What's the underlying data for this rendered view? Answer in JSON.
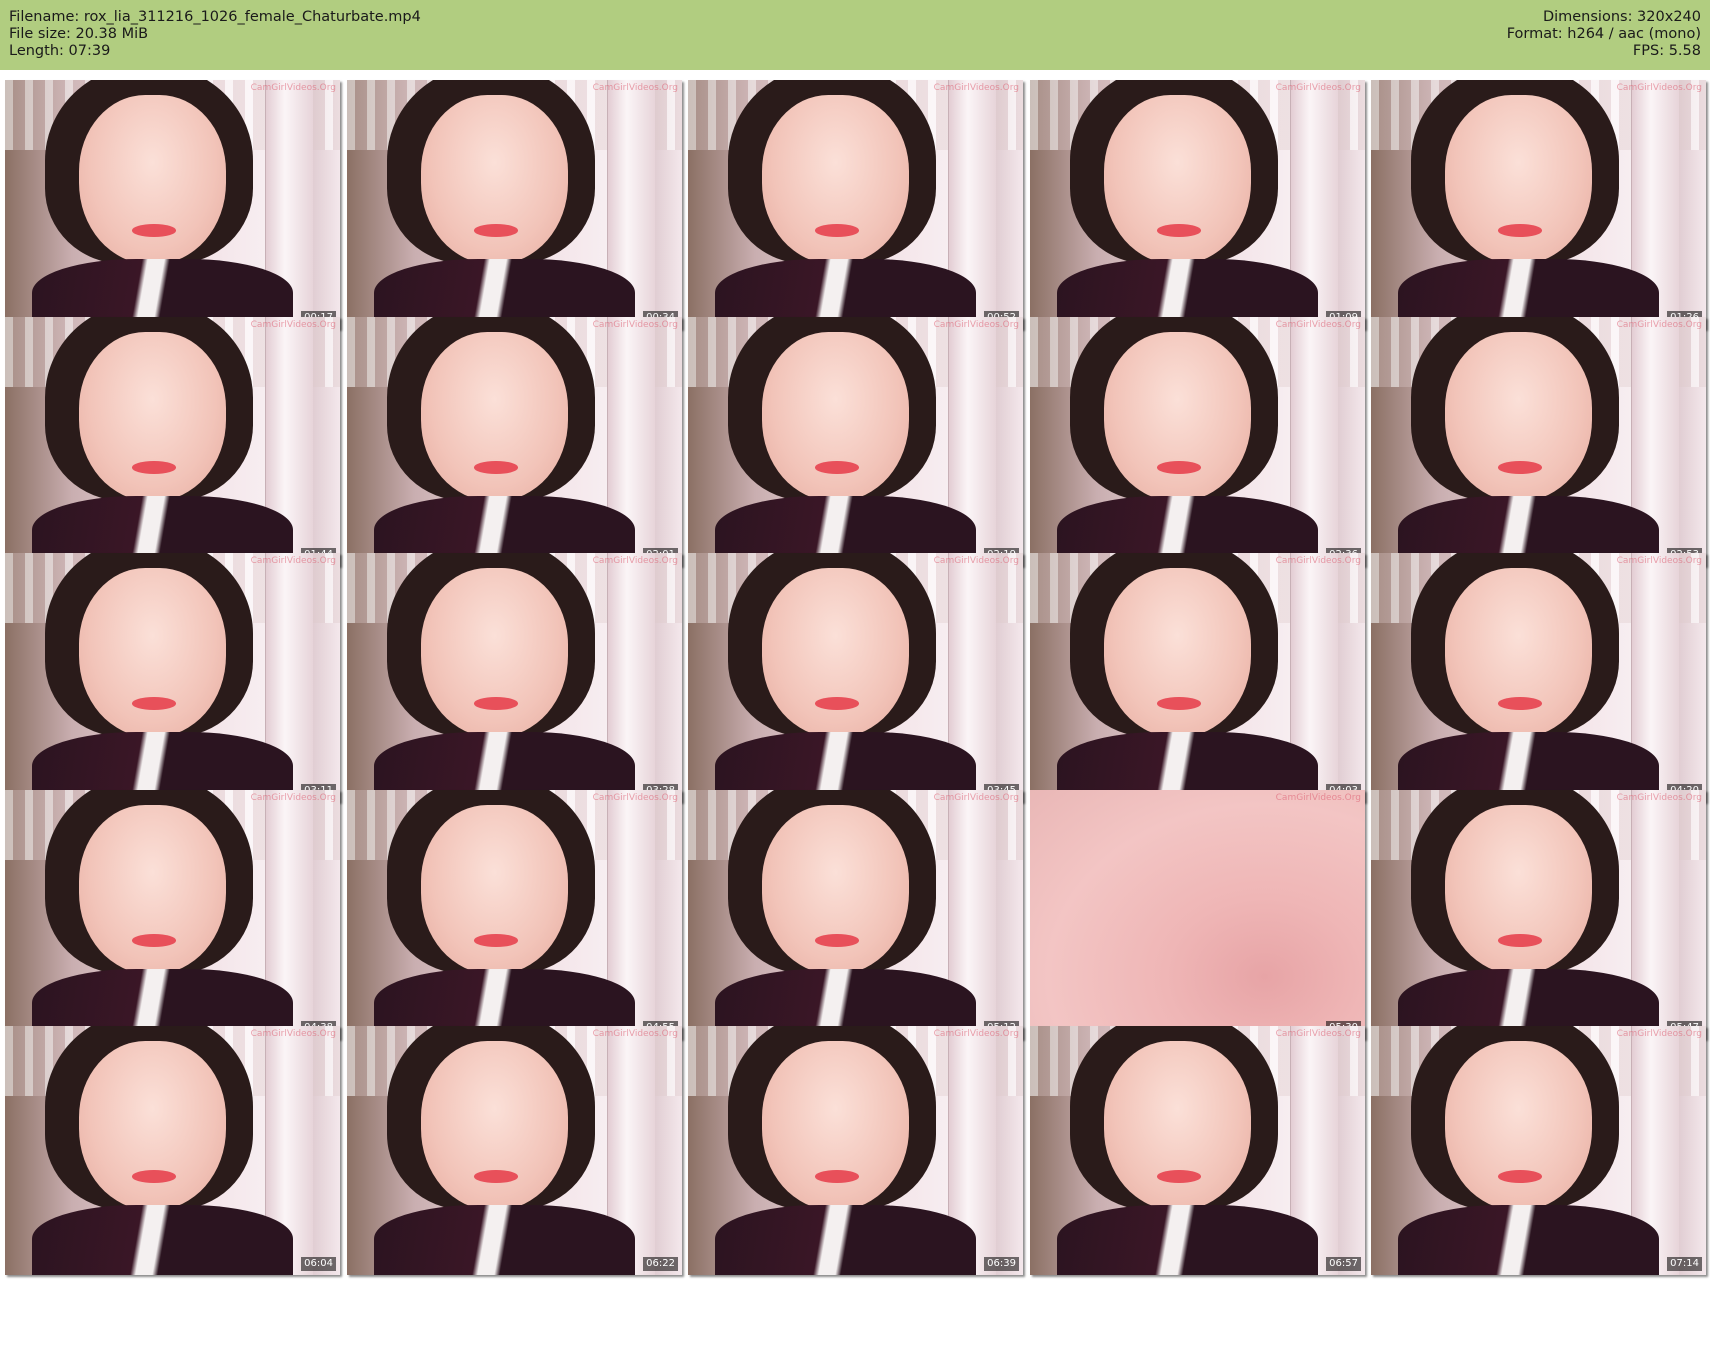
{
  "header": {
    "filename": "Filename: rox_lia_311216_1026_female_Chaturbate.mp4",
    "filesize": "File size: 20.38 MiB",
    "length": "Length: 07:39",
    "dimensions": "Dimensions: 320x240",
    "format": "Format: h264 / aac (mono)",
    "fps": "FPS: 5.58"
  },
  "watermark": "CamGirlVideos.Org",
  "thumbnails": [
    {
      "time": "00:17"
    },
    {
      "time": "00:34"
    },
    {
      "time": "00:52"
    },
    {
      "time": "01:09"
    },
    {
      "time": "01:26"
    },
    {
      "time": "01:44"
    },
    {
      "time": "02:01"
    },
    {
      "time": "02:19"
    },
    {
      "time": "02:36"
    },
    {
      "time": "02:53"
    },
    {
      "time": "03:11"
    },
    {
      "time": "03:28"
    },
    {
      "time": "03:45"
    },
    {
      "time": "04:03"
    },
    {
      "time": "04:20"
    },
    {
      "time": "04:38"
    },
    {
      "time": "04:55"
    },
    {
      "time": "05:12"
    },
    {
      "time": "05:30"
    },
    {
      "time": "05:47"
    },
    {
      "time": "06:04"
    },
    {
      "time": "06:22"
    },
    {
      "time": "06:39"
    },
    {
      "time": "06:57"
    },
    {
      "time": "07:14"
    }
  ]
}
